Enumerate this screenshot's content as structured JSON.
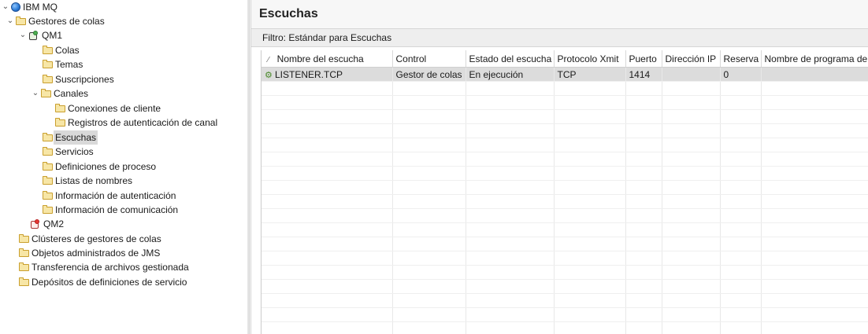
{
  "tree": {
    "items": [
      {
        "label": "IBM MQ",
        "level": 0,
        "expanded": true,
        "icon": "globe-icon"
      },
      {
        "label": "Gestores de colas",
        "level": 1,
        "expanded": true,
        "icon": "folder-icon"
      },
      {
        "label": "QM1",
        "level": 2,
        "expanded": true,
        "icon": "queue-manager-running-icon"
      },
      {
        "label": "Colas",
        "level": 3,
        "icon": "folder-icon"
      },
      {
        "label": "Temas",
        "level": 3,
        "icon": "folder-icon"
      },
      {
        "label": "Suscripciones",
        "level": 3,
        "icon": "folder-icon"
      },
      {
        "label": "Canales",
        "level": 3,
        "expanded": true,
        "icon": "folder-icon"
      },
      {
        "label": "Conexiones de cliente",
        "level": 4,
        "icon": "folder-icon"
      },
      {
        "label": "Registros de autenticación de canal",
        "level": 4,
        "icon": "folder-icon"
      },
      {
        "label": "Escuchas",
        "level": 3,
        "icon": "folder-icon",
        "selected": true
      },
      {
        "label": "Servicios",
        "level": 3,
        "icon": "folder-icon"
      },
      {
        "label": "Definiciones de proceso",
        "level": 3,
        "icon": "folder-icon"
      },
      {
        "label": "Listas de nombres",
        "level": 3,
        "icon": "folder-icon"
      },
      {
        "label": "Información de autenticación",
        "level": 3,
        "icon": "folder-icon"
      },
      {
        "label": "Información de comunicación",
        "level": 3,
        "icon": "folder-icon"
      },
      {
        "label": "QM2",
        "level": 2,
        "icon": "queue-manager-stopped-icon"
      },
      {
        "label": "Clústeres de gestores de colas",
        "level": 1,
        "icon": "folder-icon"
      },
      {
        "label": "Objetos administrados de JMS",
        "level": 1,
        "icon": "folder-icon"
      },
      {
        "label": "Transferencia de archivos gestionada",
        "level": 1,
        "icon": "folder-icon"
      },
      {
        "label": "Depósitos de definiciones de servicio",
        "level": 1,
        "icon": "folder-icon"
      }
    ]
  },
  "editor": {
    "title": "Escuchas",
    "filter": "Filtro:  Estándar para Escuchas",
    "columns": [
      "Nombre del escucha",
      "Control",
      "Estado del escucha",
      "Protocolo Xmit",
      "Puerto",
      "Dirección IP",
      "Reserva",
      "Nombre de programa de"
    ],
    "rows": [
      [
        "LISTENER.TCP",
        "Gestor de colas",
        "En ejecución",
        "TCP",
        "1414",
        "",
        "0",
        ""
      ]
    ]
  },
  "colors": {
    "selection": "#dcdcdc",
    "qm_running": "#4caf50",
    "qm_stopped": "#e53935",
    "folder": "#f7e6a6"
  }
}
